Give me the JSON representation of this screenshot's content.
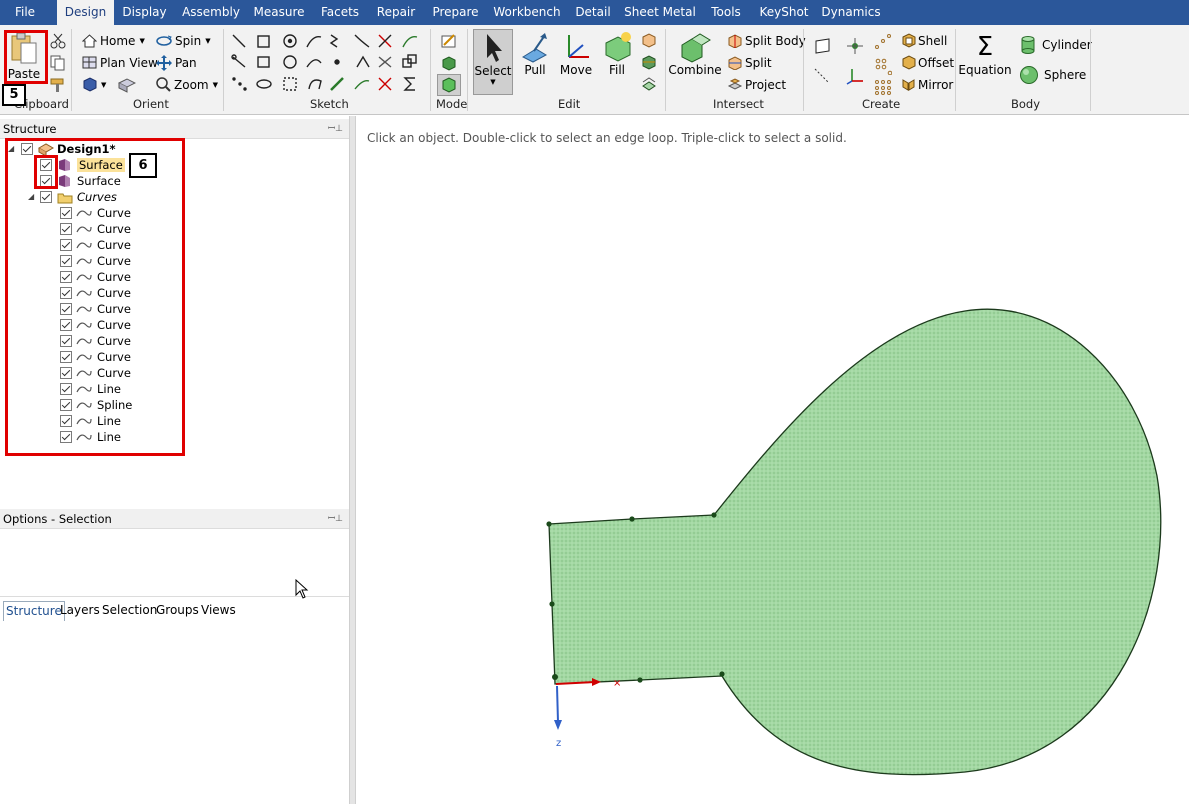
{
  "menu": [
    "File",
    "Design",
    "Display",
    "Assembly",
    "Measure",
    "Facets",
    "Repair",
    "Prepare",
    "Workbench",
    "Detail",
    "Sheet Metal",
    "Tools",
    "KeyShot",
    "Dynamics"
  ],
  "ribbon": {
    "clipboard": {
      "group": "Clipboard",
      "paste": "Paste"
    },
    "orient": {
      "group": "Orient",
      "home": "Home",
      "spin": "Spin",
      "plan_view": "Plan View",
      "pan": "Pan",
      "zoom": "Zoom"
    },
    "sketch": {
      "group": "Sketch"
    },
    "mode": {
      "group": "Mode"
    },
    "edit": {
      "group": "Edit",
      "select": "Select",
      "pull": "Pull",
      "move": "Move",
      "fill": "Fill"
    },
    "intersect": {
      "group": "Intersect",
      "combine": "Combine",
      "split_body": "Split Body",
      "split": "Split",
      "project": "Project"
    },
    "create": {
      "group": "Create",
      "shell": "Shell",
      "offset": "Offset",
      "mirror": "Mirror"
    },
    "body": {
      "group": "Body",
      "equation": "Equation",
      "cylinder": "Cylinder",
      "sphere": "Sphere"
    }
  },
  "structure": {
    "title": "Structure",
    "root": "Design1*",
    "surfaces": [
      "Surface",
      "Surface"
    ],
    "curves_folder": "Curves",
    "curves": [
      "Curve",
      "Curve",
      "Curve",
      "Curve",
      "Curve",
      "Curve",
      "Curve",
      "Curve",
      "Curve",
      "Curve",
      "Curve",
      "Line",
      "Spline",
      "Line",
      "Line"
    ]
  },
  "tabs": [
    "Structure",
    "Layers",
    "Selection",
    "Groups",
    "Views"
  ],
  "options_title": "Options - Selection",
  "callouts": {
    "paste_step": "5",
    "surface_step": "6"
  },
  "viewport": {
    "hint": "Click an object. Double-click to select an edge loop. Triple-click to select a solid.",
    "axis_label": "z"
  },
  "colors": {
    "ribbon_blue": "#2b579a",
    "surface_fill": "#9fd69f",
    "highlight": "#e00000"
  }
}
